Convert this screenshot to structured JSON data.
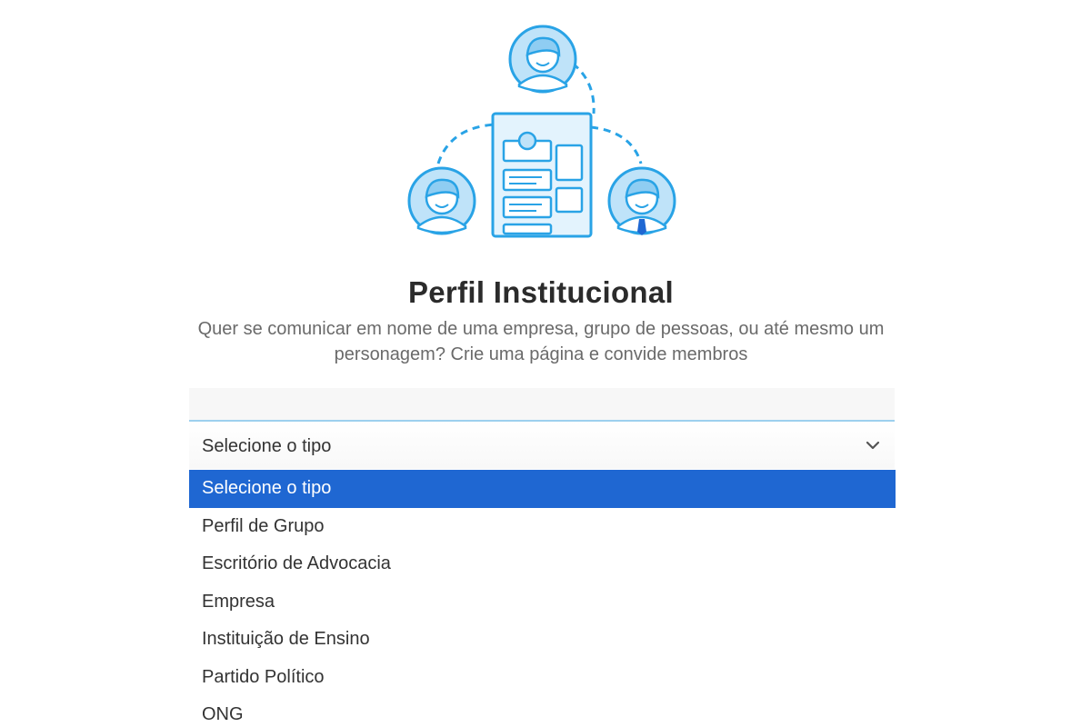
{
  "page": {
    "title": "Perfil Institucional",
    "description": "Quer se comunicar em nome de uma empresa, grupo de pessoas, ou até mesmo um personagem? Crie uma página e convide membros"
  },
  "illustration": {
    "icon": "people-connected-to-profile-document",
    "accent_color": "#29a3e6"
  },
  "select": {
    "value": "Selecione o tipo",
    "chevron_icon": "chevron-down-icon",
    "options": [
      {
        "label": "Selecione o tipo",
        "highlighted": true
      },
      {
        "label": "Perfil de Grupo",
        "highlighted": false
      },
      {
        "label": "Escritório de Advocacia",
        "highlighted": false
      },
      {
        "label": "Empresa",
        "highlighted": false
      },
      {
        "label": "Instituição de Ensino",
        "highlighted": false
      },
      {
        "label": "Partido Político",
        "highlighted": false
      },
      {
        "label": "ONG",
        "highlighted": false
      }
    ]
  },
  "colors": {
    "highlight": "#1f67d2",
    "field_underline": "#9dd0ee",
    "title_text": "#2b2b2b",
    "subtitle_text": "#6a6a6a"
  }
}
